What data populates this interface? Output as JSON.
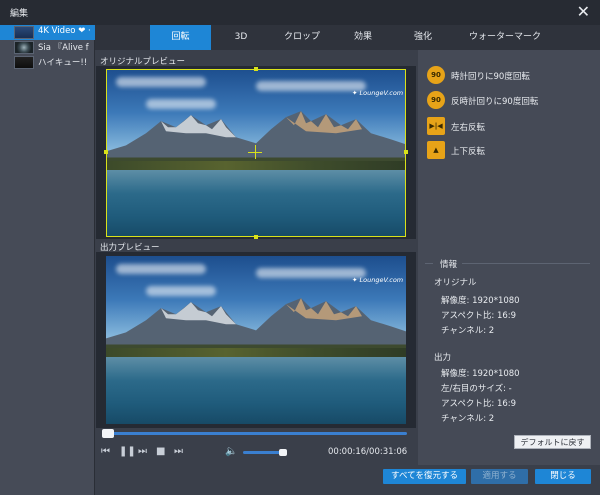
{
  "window": {
    "title": "編集",
    "close_icon": "close-icon"
  },
  "files": [
    {
      "name": "4K Video ❤ ·",
      "selected": true
    },
    {
      "name": "Sia 『Alive f",
      "selected": false
    },
    {
      "name": "ハイキュー!!",
      "selected": false
    }
  ],
  "tabs": [
    "回転",
    "3D",
    "クロップ",
    "効果",
    "強化",
    "ウォーターマーク"
  ],
  "active_tab": "回転",
  "preview": {
    "original_label": "オリジナルプレビュー",
    "output_label": "出力プレビュー",
    "watermark": "✦ LoungeV.com"
  },
  "player": {
    "progress": 0.0,
    "volume": 0.8,
    "timecode": "00:00:16/00:31:06",
    "controls": [
      "first-frame-icon",
      "pause-icon",
      "next-frame-icon",
      "stop-icon",
      "last-frame-icon",
      "volume-icon"
    ]
  },
  "rotate_actions": [
    {
      "label": "時計回りに90度回転",
      "icon": "rotate-clockwise-icon",
      "icon_text": "90"
    },
    {
      "label": "反時計回りに90度回転",
      "icon": "rotate-counterclockwise-icon",
      "icon_text": "90"
    },
    {
      "label": "左右反転",
      "icon": "flip-horizontal-icon",
      "icon_text": "▶|◀"
    },
    {
      "label": "上下反転",
      "icon": "flip-vertical-icon",
      "icon_text": "▲"
    }
  ],
  "info": {
    "legend": "情報",
    "original_heading": "オリジナル",
    "original_resolution": "解像度: 1920*1080",
    "original_aspect": "アスペクト比: 16:9",
    "original_channels": "チャンネル: 2",
    "output_heading": "出力",
    "output_resolution": "解像度: 1920*1080",
    "output_lr_size": "左/右目のサイズ: -",
    "output_aspect": "アスペクト比: 16:9",
    "output_channels": "チャンネル: 2"
  },
  "buttons": {
    "reset_default": "デフォルトに戻す",
    "restore_all": "すべてを復元する",
    "apply": "適用する",
    "close": "閉じる"
  },
  "colors": {
    "accent": "#1e86d6",
    "crop_frame": "#d9e21a",
    "icon_orange": "#e7a318"
  }
}
